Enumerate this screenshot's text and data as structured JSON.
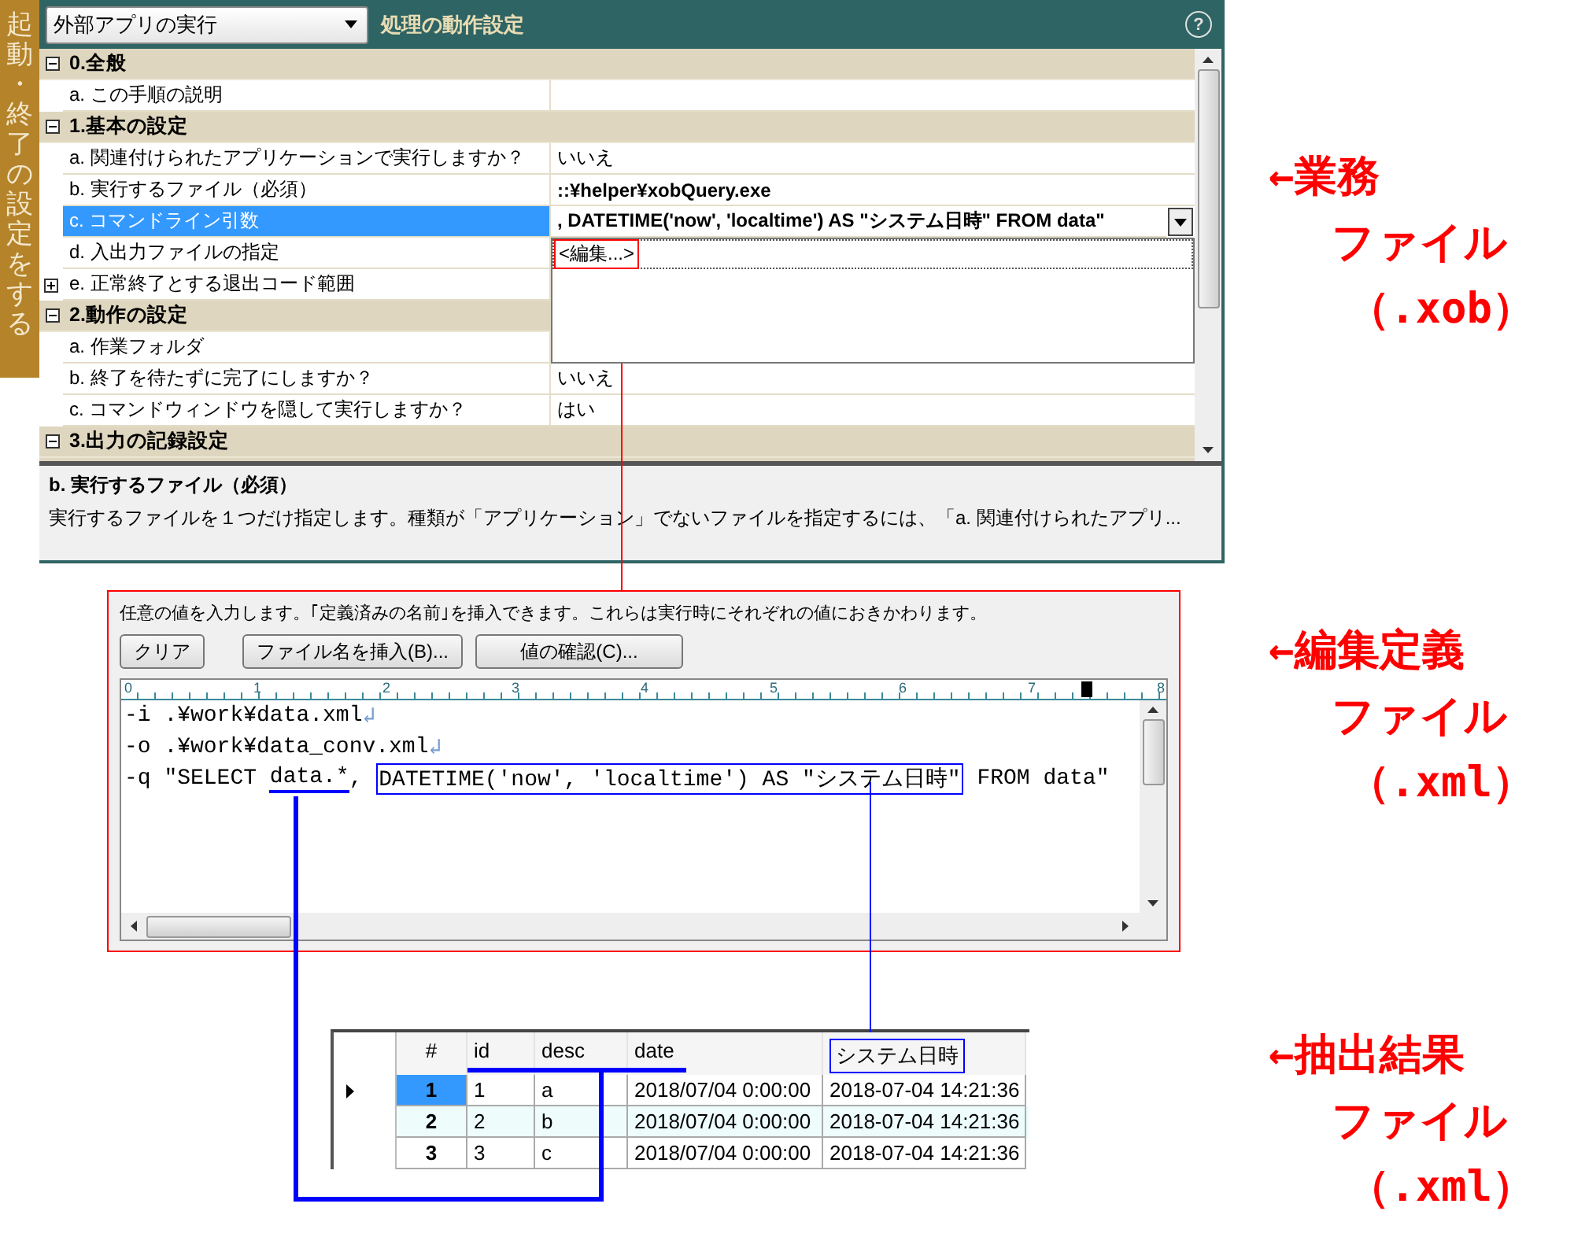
{
  "side_tab": {
    "label": "起動・終了の設定をする"
  },
  "header": {
    "select": "外部アプリの実行",
    "title": "処理の動作設定",
    "help": "?"
  },
  "property_grid": {
    "groups": [
      {
        "title": "0.全般",
        "expanded": true,
        "items": [
          {
            "label": "a. この手順の説明",
            "value": "",
            "emphasized": false,
            "selected": false
          }
        ]
      },
      {
        "title": "1.基本の設定",
        "expanded": true,
        "items": [
          {
            "label": "a. 関連付けられたアプリケーションで実行しますか？",
            "value": "いいえ",
            "emphasized": false,
            "selected": false
          },
          {
            "label": "b. 実行するファイル（必須）",
            "value": "::¥helper¥xobQuery.exe",
            "emphasized": true,
            "selected": false
          },
          {
            "label": "c. コマンドライン引数",
            "value": ", DATETIME('now', 'localtime') AS \"システム日時\" FROM data\"",
            "emphasized": true,
            "selected": true,
            "dropdown": {
              "items": [
                "<編集...>"
              ]
            }
          },
          {
            "label": "d. 入出力ファイルの指定",
            "value": "",
            "emphasized": false,
            "selected": false
          },
          {
            "label": "e. 正常終了とする退出コード範囲",
            "value": "",
            "emphasized": false,
            "selected": false,
            "expanded": false
          }
        ]
      },
      {
        "title": "2.動作の設定",
        "expanded": true,
        "items": [
          {
            "label": "a. 作業フォルダ",
            "value": "",
            "emphasized": false,
            "selected": false
          },
          {
            "label": "b. 終了を待たずに完了にしますか？",
            "value": "いいえ",
            "emphasized": false,
            "selected": false
          },
          {
            "label": "c. コマンドウィンドウを隠して実行しますか？",
            "value": "はい",
            "emphasized": false,
            "selected": false
          }
        ]
      },
      {
        "title": "3.出力の記録設定",
        "expanded": true
      }
    ]
  },
  "description": {
    "title": "b. 実行するファイル（必須）",
    "text": "実行するファイルを１つだけ指定します。種類が「アプリケーション」でないファイルを指定するには、「a. 関連付けられたアプリ..."
  },
  "editor": {
    "instruction": "任意の値を入力します。｢定義済みの名前｣を挿入できます。これらは実行時にそれぞれの値におきかわります。",
    "buttons": [
      "クリア",
      "ファイル名を挿入(B)...",
      "値の確認(C)..."
    ],
    "ruler": [
      "0",
      "1",
      "2",
      "3",
      "4",
      "5",
      "6",
      "7",
      "8"
    ],
    "lines": [
      {
        "segments": [
          {
            "text": "-i .¥work¥data.xml",
            "underlined": false,
            "boxed": false
          }
        ],
        "eol": "↲"
      },
      {
        "segments": [
          {
            "text": "-o .¥work¥data_conv.xml",
            "underlined": false,
            "boxed": false
          }
        ],
        "eol": "↲"
      },
      {
        "segments": [
          {
            "text": "-q \"SELECT ",
            "underlined": false,
            "boxed": false
          },
          {
            "text": "data.*",
            "underlined": true,
            "boxed": false
          },
          {
            "text": ", ",
            "underlined": false,
            "boxed": false
          },
          {
            "text": "DATETIME('now', 'localtime') AS \"システム日時\"",
            "underlined": false,
            "boxed": true
          },
          {
            "text": " FROM data\"",
            "underlined": false,
            "boxed": false
          }
        ]
      }
    ]
  },
  "result_table": {
    "columns": [
      {
        "label": "#",
        "boxed": false
      },
      {
        "label": "id",
        "boxed": false
      },
      {
        "label": "desc",
        "boxed": false
      },
      {
        "label": "date",
        "boxed": false
      },
      {
        "label": "システム日時",
        "boxed": true
      }
    ],
    "rows": [
      {
        "selected": true,
        "cells": [
          "1",
          "1",
          "a",
          "2018/07/04 0:00:00",
          "2018-07-04 14:21:36"
        ]
      },
      {
        "selected": false,
        "cells": [
          "2",
          "2",
          "b",
          "2018/07/04 0:00:00",
          "2018-07-04 14:21:36"
        ]
      },
      {
        "selected": false,
        "cells": [
          "3",
          "3",
          "c",
          "2018/07/04 0:00:00",
          "2018-07-04 14:21:36"
        ]
      }
    ]
  },
  "annotations": [
    {
      "lines": [
        "←業務",
        "ファイル",
        "（.xob）"
      ]
    },
    {
      "lines": [
        "←編集定義",
        "ファイル",
        "（.xml）"
      ]
    },
    {
      "lines": [
        "←抽出結果",
        "ファイル",
        "（.xml）"
      ]
    }
  ]
}
